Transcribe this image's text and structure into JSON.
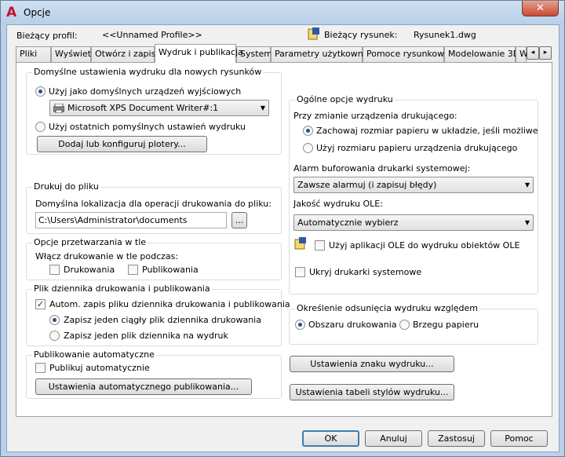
{
  "window": {
    "title": "Opcje",
    "close_glyph": "✕",
    "app_icon": "A"
  },
  "header": {
    "profile_label": "Bieżący profil:",
    "profile_value": "<<Unnamed Profile>>",
    "drawing_label": "Bieżący rysunek:",
    "drawing_value": "Rysunek1.dwg"
  },
  "tabs": [
    {
      "label": "Pliki"
    },
    {
      "label": "Wyświetl"
    },
    {
      "label": "Otwórz i zapisz"
    },
    {
      "label": "Wydruk i publikacja"
    },
    {
      "label": "System"
    },
    {
      "label": "Parametry użytkownika"
    },
    {
      "label": "Pomoce rysunkowe"
    },
    {
      "label": "Modelowanie 3D"
    },
    {
      "label": "W"
    }
  ],
  "tab_scroll": {
    "left": "◂",
    "right": "▸"
  },
  "default_print": {
    "group": "Domyślne ustawienia wydruku dla nowych rysunków",
    "opt_default_device": "Użyj jako domyślnych urządzeń wyjściowych",
    "device_value": "Microsoft XPS Document Writer#:1",
    "opt_last_successful": "Użyj ostatnich pomyślnych ustawień wydruku",
    "add_plotters": "Dodaj lub konfiguruj plotery..."
  },
  "print_to_file": {
    "group": "Drukuj do pliku",
    "location_label": "Domyślna lokalizacja dla operacji drukowania do pliku:",
    "path": "C:\\Users\\Administrator\\documents",
    "browse": "..."
  },
  "background": {
    "group": "Opcje przetwarzania w tle",
    "enable_label": "Włącz drukowanie w tle podczas:",
    "printing": "Drukowania",
    "publishing": "Publikowania"
  },
  "log_file": {
    "group": "Plik dziennika drukowania i publikowania",
    "auto_save": "Autom. zapis pliku dziennika drukowania i publikowania",
    "single": "Zapisz jeden ciągły plik dziennika drukowania",
    "per_plot": "Zapisz jeden plik dziennika na wydruk"
  },
  "auto_publish": {
    "group": "Publikowanie automatyczne",
    "checkbox": "Publikuj automatycznie",
    "settings": "Ustawienia automatycznego publikowania..."
  },
  "general": {
    "group": "Ogólne opcje wydruku",
    "change_device_label": "Przy zmianie urządzenia drukującego:",
    "keep_paper": "Zachowaj rozmiar papieru w układzie, jeśli możliwe",
    "use_device_paper": "Użyj rozmiaru papieru urządzenia drukującego",
    "spool_label": "Alarm buforowania drukarki systemowej:",
    "spool_value": "Zawsze alarmuj (i zapisuj błędy)",
    "ole_label": "Jakość wydruku OLE:",
    "ole_value": "Automatycznie wybierz",
    "use_ole_app": "Użyj aplikacji OLE do wydruku obiektów OLE",
    "hide_printers": "Ukryj drukarki systemowe"
  },
  "offset": {
    "group": "Określenie odsunięcia wydruku względem",
    "printable": "Obszaru drukowania",
    "paper_edge": "Brzegu papieru"
  },
  "stamp_btn": "Ustawienia znaku wydruku...",
  "plotstyle_btn": "Ustawienia tabeli stylów wydruku...",
  "footer": {
    "ok": "OK",
    "cancel": "Anuluj",
    "apply": "Zastosuj",
    "help": "Pomoc"
  }
}
